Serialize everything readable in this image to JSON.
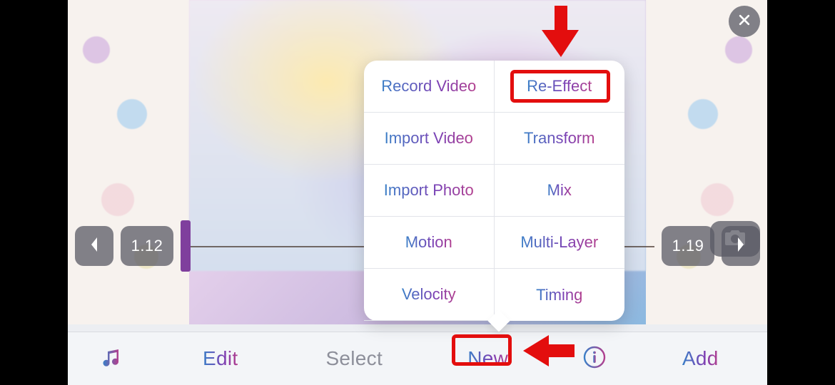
{
  "popover": {
    "items": [
      {
        "label": "Record Video"
      },
      {
        "label": "Re-Effect"
      },
      {
        "label": "Import Video"
      },
      {
        "label": "Transform"
      },
      {
        "label": "Import Photo"
      },
      {
        "label": "Mix"
      },
      {
        "label": "Motion"
      },
      {
        "label": "Multi-Layer"
      },
      {
        "label": "Velocity"
      },
      {
        "label": "Timing"
      }
    ]
  },
  "timeline": {
    "time_left": "1.12",
    "time_right": "1.19"
  },
  "tabbar": {
    "edit": "Edit",
    "select": "Select",
    "new": "New",
    "add": "Add"
  },
  "colors": {
    "highlight": "#e30e0e",
    "gradient_start": "#3a7fc7",
    "gradient_end": "#b23f8e"
  }
}
